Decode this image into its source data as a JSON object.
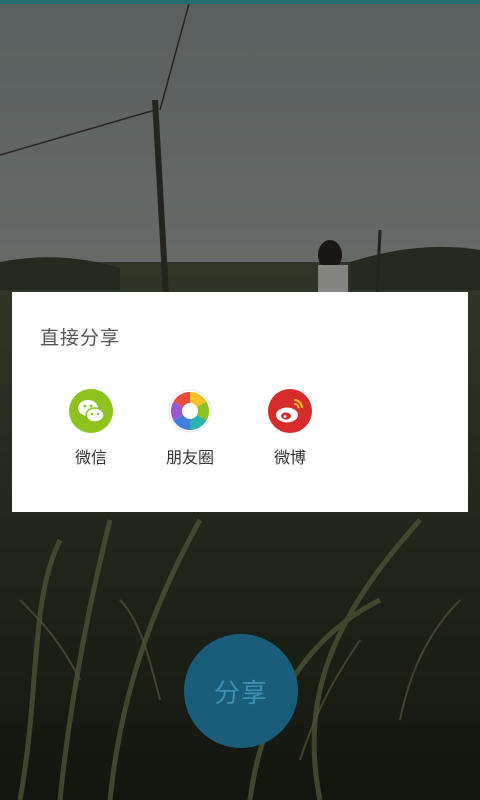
{
  "dialog": {
    "title": "直接分享",
    "options": [
      {
        "label": "微信",
        "icon": "wechat-icon",
        "color": "#8dc21f"
      },
      {
        "label": "朋友圈",
        "icon": "moments-icon",
        "color": "multicolor"
      },
      {
        "label": "微博",
        "icon": "weibo-icon",
        "color": "#d52b2b"
      }
    ]
  },
  "main": {
    "share_button_label": "分享",
    "share_button_color": "#1a5d7a"
  },
  "theme": {
    "status_strip_color": "#1f6f73",
    "dialog_background": "#ffffff"
  }
}
